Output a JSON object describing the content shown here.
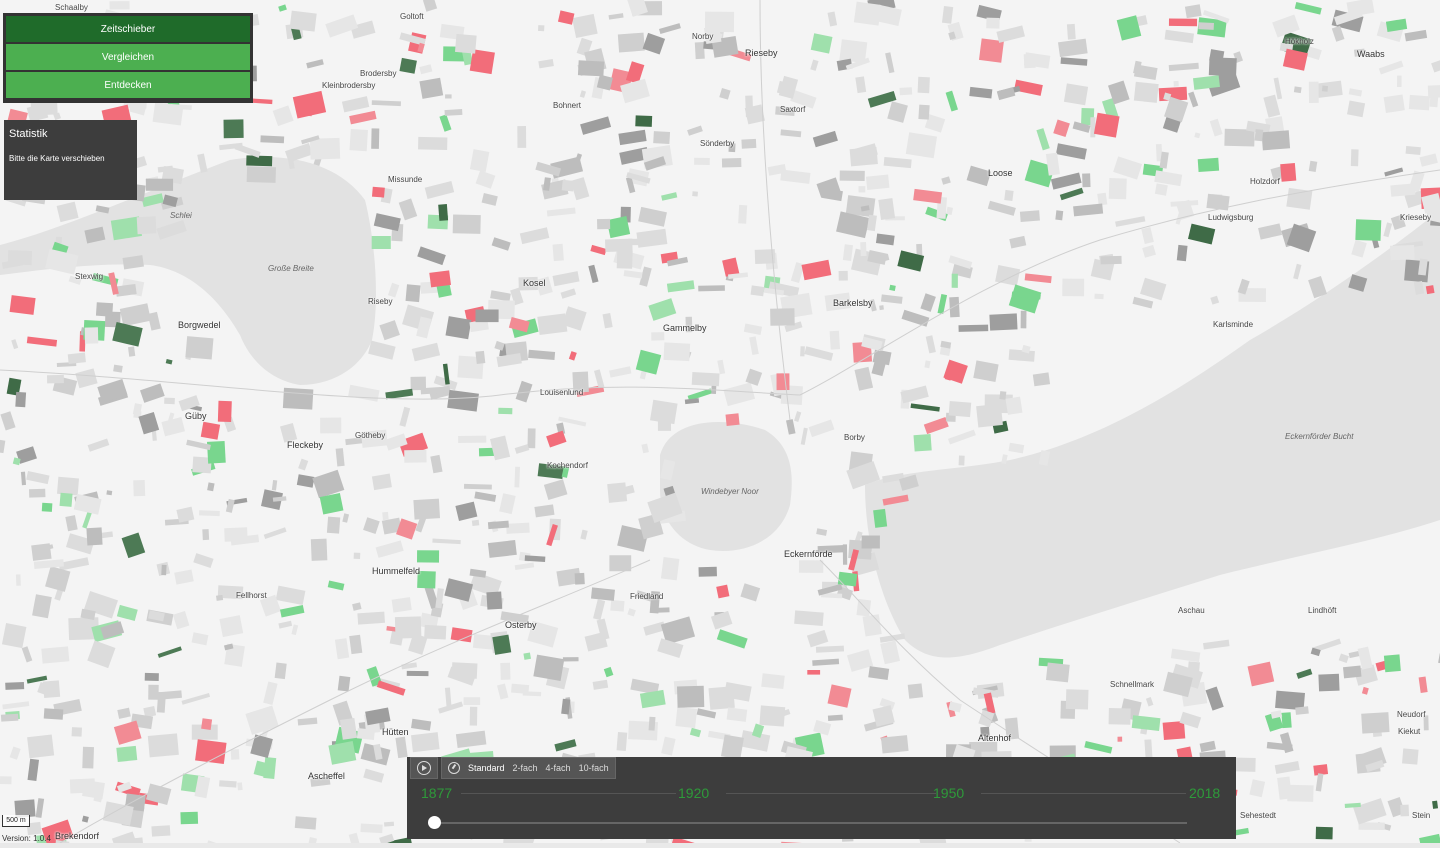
{
  "tabs": [
    {
      "label": "Zeitschieber",
      "active": true
    },
    {
      "label": "Vergleichen",
      "active": false
    },
    {
      "label": "Entdecken",
      "active": false
    }
  ],
  "stats": {
    "title": "Statistik",
    "message": "Bitte die Karte verschieben"
  },
  "timeline": {
    "speed_label": "Standard",
    "speeds": [
      "2-fach",
      "4-fach",
      "10-fach"
    ],
    "years": [
      "1877",
      "1920",
      "1950",
      "2018"
    ],
    "current_year": 1877
  },
  "scale_label": "500 m",
  "version": "Version: 1.0.4",
  "places": [
    {
      "name": "Schaalby",
      "cls": ""
    },
    {
      "name": "Goltoft",
      "cls": ""
    },
    {
      "name": "Brodersby",
      "cls": ""
    },
    {
      "name": "Kleinbrodersby",
      "cls": ""
    },
    {
      "name": "Missunde",
      "cls": ""
    },
    {
      "name": "Schlei",
      "cls": "water"
    },
    {
      "name": "Große Breite",
      "cls": "water"
    },
    {
      "name": "Riseby",
      "cls": ""
    },
    {
      "name": "Stexwig",
      "cls": ""
    },
    {
      "name": "Borgwedel",
      "cls": "big"
    },
    {
      "name": "Güby",
      "cls": "big"
    },
    {
      "name": "Fleckeby",
      "cls": "big"
    },
    {
      "name": "Götheby",
      "cls": ""
    },
    {
      "name": "Louisenlund",
      "cls": ""
    },
    {
      "name": "Rieseby",
      "cls": "big"
    },
    {
      "name": "Norby",
      "cls": ""
    },
    {
      "name": "Bohnert",
      "cls": ""
    },
    {
      "name": "Saxtorf",
      "cls": ""
    },
    {
      "name": "Sönderby",
      "cls": ""
    },
    {
      "name": "Kosel",
      "cls": "big"
    },
    {
      "name": "Gammelby",
      "cls": "big"
    },
    {
      "name": "Barkelsby",
      "cls": "big"
    },
    {
      "name": "Loose",
      "cls": "big"
    },
    {
      "name": "Waabs",
      "cls": "big"
    },
    {
      "name": "Hökholz",
      "cls": ""
    },
    {
      "name": "Ludwigsburg",
      "cls": ""
    },
    {
      "name": "Karlsminde",
      "cls": ""
    },
    {
      "name": "Kochendorf",
      "cls": ""
    },
    {
      "name": "Windebyer Noor",
      "cls": "water"
    },
    {
      "name": "Borby",
      "cls": ""
    },
    {
      "name": "Eckernförde",
      "cls": "big"
    },
    {
      "name": "Eckernförder Bucht",
      "cls": "water"
    },
    {
      "name": "Hummelfeld",
      "cls": "big"
    },
    {
      "name": "Friedland",
      "cls": ""
    },
    {
      "name": "Osterby",
      "cls": "big"
    },
    {
      "name": "Fellhorst",
      "cls": ""
    },
    {
      "name": "Hütten",
      "cls": "big"
    },
    {
      "name": "Ascheffel",
      "cls": "big"
    },
    {
      "name": "Brekendorf",
      "cls": "big"
    },
    {
      "name": "Altenhof",
      "cls": "big"
    },
    {
      "name": "Schnellmark",
      "cls": ""
    },
    {
      "name": "Aschau",
      "cls": ""
    },
    {
      "name": "Lindhöft",
      "cls": ""
    },
    {
      "name": "Neudorf",
      "cls": ""
    },
    {
      "name": "Kiekut",
      "cls": ""
    },
    {
      "name": "Holzdorf",
      "cls": ""
    },
    {
      "name": "Krieseby",
      "cls": ""
    },
    {
      "name": "Stein",
      "cls": ""
    },
    {
      "name": "Sehestedt",
      "cls": ""
    }
  ]
}
